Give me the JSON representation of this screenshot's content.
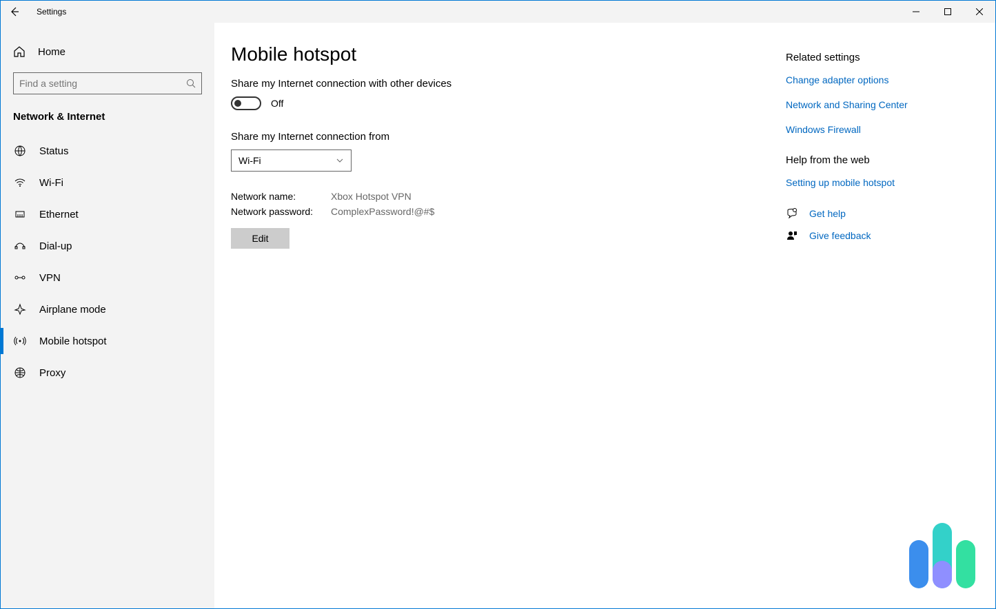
{
  "window": {
    "title": "Settings"
  },
  "sidebar": {
    "home": "Home",
    "search_placeholder": "Find a setting",
    "category": "Network & Internet",
    "items": [
      {
        "label": "Status"
      },
      {
        "label": "Wi-Fi"
      },
      {
        "label": "Ethernet"
      },
      {
        "label": "Dial-up"
      },
      {
        "label": "VPN"
      },
      {
        "label": "Airplane mode"
      },
      {
        "label": "Mobile hotspot"
      },
      {
        "label": "Proxy"
      }
    ]
  },
  "page": {
    "title": "Mobile hotspot",
    "share_label": "Share my Internet connection with other devices",
    "toggle_state": "Off",
    "share_from_label": "Share my Internet connection from",
    "share_from_value": "Wi-Fi",
    "network_name_label": "Network name:",
    "network_name_value": "Xbox Hotspot VPN",
    "network_password_label": "Network password:",
    "network_password_value": "ComplexPassword!@#$",
    "edit_button": "Edit"
  },
  "right": {
    "related_heading": "Related settings",
    "links": [
      "Change adapter options",
      "Network and Sharing Center",
      "Windows Firewall"
    ],
    "help_heading": "Help from the web",
    "help_links": [
      "Setting up mobile hotspot"
    ],
    "get_help": "Get help",
    "give_feedback": "Give feedback"
  }
}
